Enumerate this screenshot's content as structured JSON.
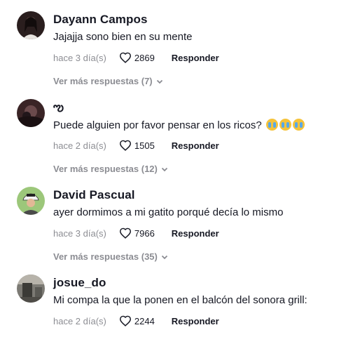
{
  "comments": [
    {
      "name": "Dayann Campos",
      "text": "Jajajja sono bien en su mente",
      "date": "hace 3 día(s)",
      "likes": "2869",
      "reply": "Responder",
      "more": "Ver más respuestas (7)",
      "avatar_icon": "user-avatar-dark-hair"
    },
    {
      "name": "ఌ",
      "text": "Puede alguien por favor pensar en los ricos?",
      "emojis": [
        "loudly-crying-face",
        "loudly-crying-face",
        "loudly-crying-face"
      ],
      "date": "hace 2 día(s)",
      "likes": "1505",
      "reply": "Responder",
      "more": "Ver más respuestas (12)",
      "avatar_icon": "user-avatar-dark"
    },
    {
      "name": "David Pascual",
      "text": "ayer dormimos a mi gatito porqué decía lo mismo",
      "date": "hace 3 día(s)",
      "likes": "7966",
      "reply": "Responder",
      "more": "Ver más respuestas (35)",
      "avatar_icon": "user-avatar-cap"
    },
    {
      "name": "josue_do",
      "text": "Mi compa la que la ponen en el balcón del sonora grill:",
      "date": "hace 2 día(s)",
      "likes": "2244",
      "reply": "Responder",
      "avatar_icon": "user-avatar-room"
    }
  ]
}
